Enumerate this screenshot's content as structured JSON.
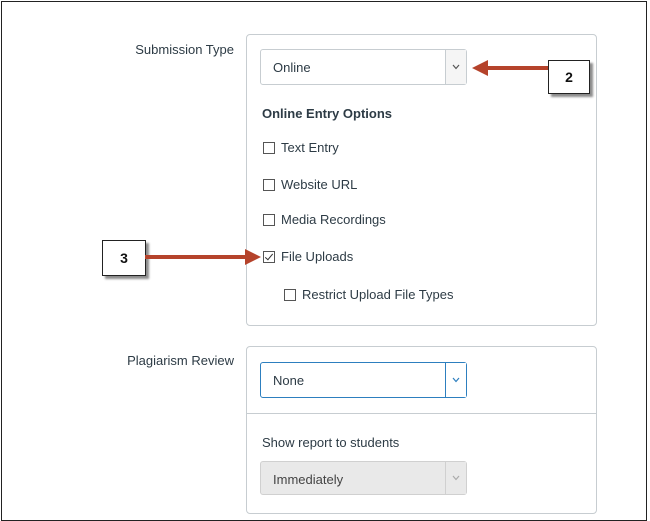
{
  "submission_type": {
    "label": "Submission Type",
    "selected": "Online",
    "options_title": "Online Entry Options",
    "options": [
      {
        "label": "Text Entry",
        "checked": false
      },
      {
        "label": "Website URL",
        "checked": false
      },
      {
        "label": "Media Recordings",
        "checked": false
      },
      {
        "label": "File Uploads",
        "checked": true
      }
    ],
    "sub_option": {
      "label": "Restrict Upload File Types",
      "checked": false
    }
  },
  "plagiarism_review": {
    "label": "Plagiarism Review",
    "selected": "None",
    "show_report_label": "Show report to students",
    "show_report_selected": "Immediately"
  },
  "callouts": {
    "step_2": "2",
    "step_3": "3"
  },
  "colors": {
    "arrow": "#b5432b",
    "focus_border": "#2d7fbf",
    "panel_border": "#c7cdd1"
  },
  "icons": {
    "dropdown_caret": "chevron-down-icon",
    "check": "checkmark-icon"
  }
}
